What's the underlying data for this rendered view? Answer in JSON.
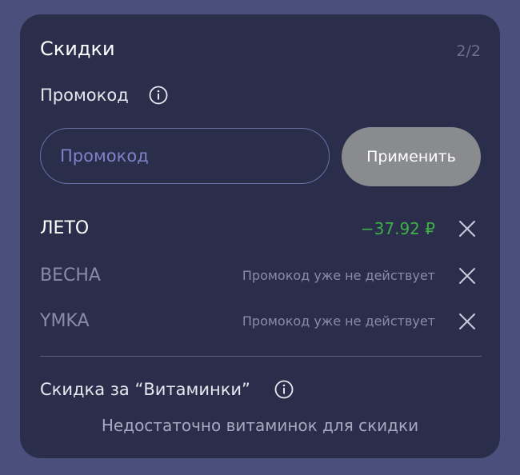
{
  "discounts": {
    "title": "Скидки",
    "counter": "2/2",
    "promo_label": "Промокод",
    "promo_input": {
      "value": "",
      "placeholder": "Промокод"
    },
    "apply_label": "Применить",
    "codes": [
      {
        "name": "ЛЕТО",
        "amount": "−37.92 ₽",
        "status": ""
      },
      {
        "name": "ВЕСНА",
        "amount": "",
        "status": "Промокод уже не действует"
      },
      {
        "name": "YMKA",
        "amount": "",
        "status": "Промокод уже не действует"
      }
    ],
    "vitamin_label": "Скидка за “Витаминки”",
    "vitamin_message": "Недостаточно витаминок для скидки"
  },
  "colors": {
    "background": "#4b4f7c",
    "card": "#2b2e4a",
    "accent_green": "#3fae4a",
    "input_border": "#6a6fa6",
    "button_bg": "#8a8b8f"
  },
  "icons": {
    "info": "info-icon",
    "remove": "close-icon"
  }
}
